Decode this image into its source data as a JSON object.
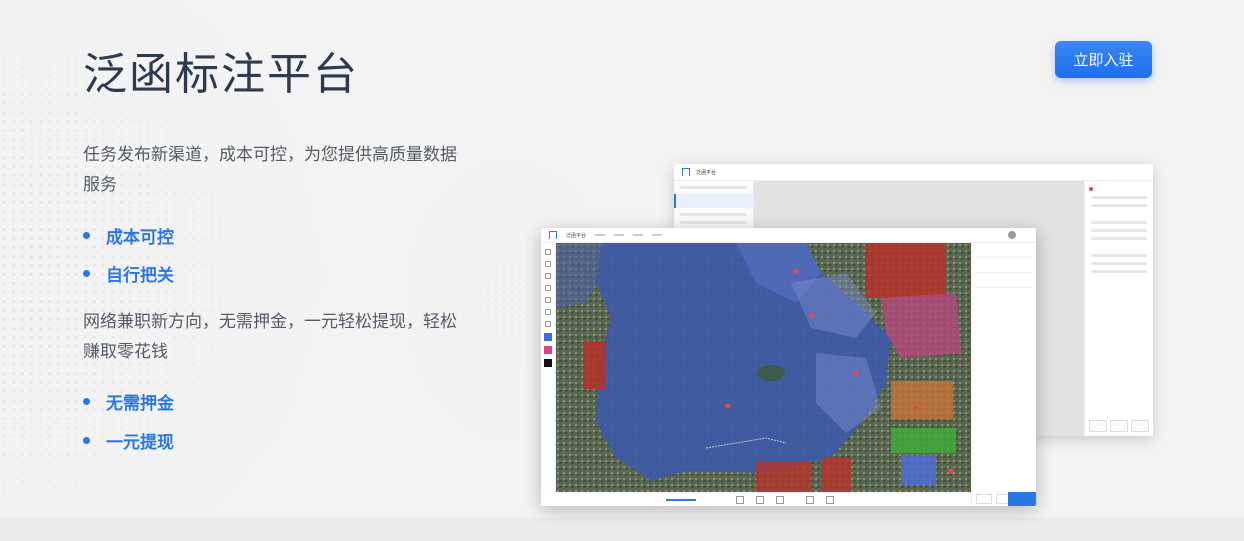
{
  "hero": {
    "title": "泛函标注平台",
    "join_button": "立即入驻",
    "section1_text": "任务发布新渠道，成本可控，为您提供高质量数据服务",
    "section1_bullets": [
      "成本可控",
      "自行把关"
    ],
    "section2_text": "网络兼职新方向，无需押金，一元轻松提现，轻松赚取零花钱",
    "section2_bullets": [
      "无需押金",
      "一元提现"
    ]
  },
  "screens": {
    "back_window_app_name": "泛函平台",
    "front_window_app_name": "泛函平台"
  },
  "colors": {
    "accent": "#2a78e4",
    "button": "#1f6ff0",
    "title": "#2e3b4e",
    "body_text": "#555b66"
  }
}
